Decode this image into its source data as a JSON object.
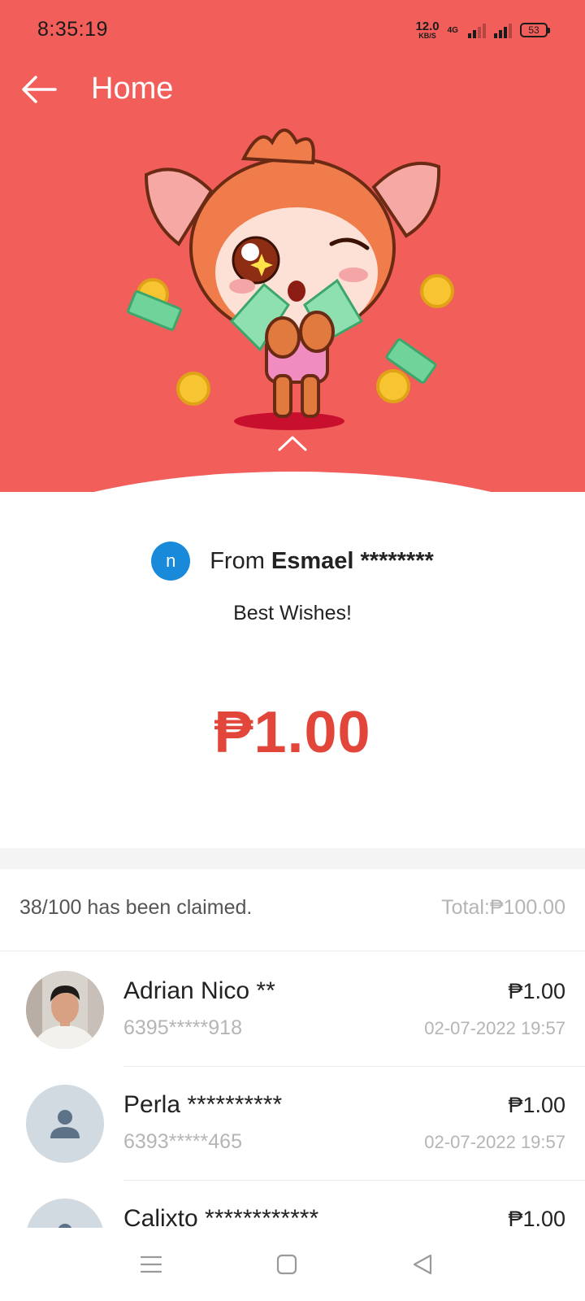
{
  "status_bar": {
    "time": "8:35:19",
    "speed_value": "12.0",
    "speed_unit": "KB/S",
    "network_label": "4G",
    "battery": "53"
  },
  "header": {
    "title": "Home",
    "background_color": "#f25e5a"
  },
  "envelope": {
    "sender_avatar_letter": "n",
    "sender_prefix": "From",
    "sender_name": "Esmael ********",
    "message": "Best Wishes!",
    "amount": "₱1.00",
    "amount_color": "#e2453a"
  },
  "summary": {
    "claimed_text": "38/100 has been claimed.",
    "total_text": "Total:₱100.00"
  },
  "claims": [
    {
      "name": "Adrian Nico **",
      "phone": "6395*****918",
      "amount": "₱1.00",
      "time": "02-07-2022 19:57",
      "avatar": "photo"
    },
    {
      "name": "Perla **********",
      "phone": "6393*****465",
      "amount": "₱1.00",
      "time": "02-07-2022 19:57",
      "avatar": "default-user-icon"
    },
    {
      "name": "Calixto ************",
      "phone": "",
      "amount": "₱1.00",
      "time": "",
      "avatar": "default-user-icon"
    }
  ],
  "icons": {
    "back": "arrow-left-icon",
    "collapse": "chevron-up-icon",
    "nav_menu": "menu-icon",
    "nav_home": "square-home-icon",
    "nav_back": "triangle-back-icon"
  }
}
